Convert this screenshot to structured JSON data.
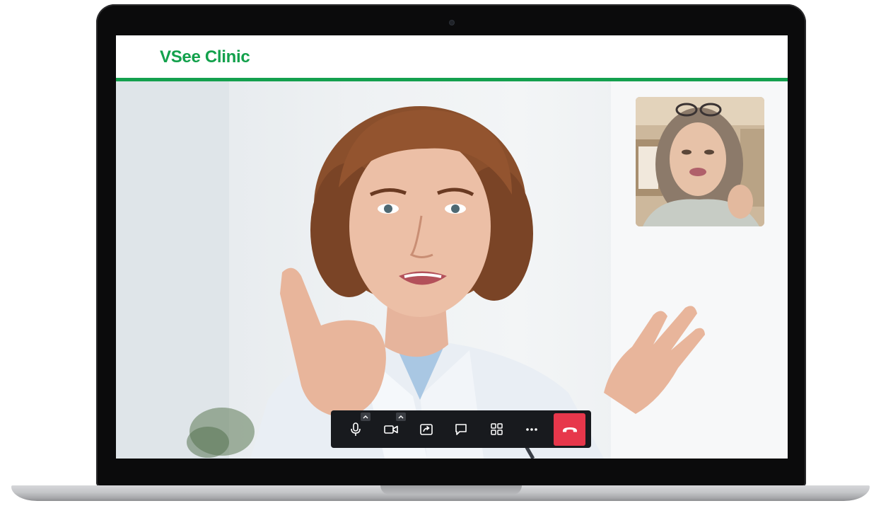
{
  "app": {
    "logo_text": "VSee Clinic",
    "brand_color": "#14a04e"
  },
  "toolbar": {
    "buttons": [
      {
        "name": "microphone",
        "icon": "microphone-icon",
        "has_menu": true
      },
      {
        "name": "camera",
        "icon": "video-camera-icon",
        "has_menu": true
      },
      {
        "name": "screen-share",
        "icon": "screen-share-icon",
        "has_menu": false
      },
      {
        "name": "chat",
        "icon": "chat-bubble-icon",
        "has_menu": false
      },
      {
        "name": "layout",
        "icon": "grid-layout-icon",
        "has_menu": false
      },
      {
        "name": "more",
        "icon": "more-dots-icon",
        "has_menu": false
      },
      {
        "name": "end-call",
        "icon": "hang-up-phone-icon",
        "has_menu": false
      }
    ],
    "end_call_color": "#e7374b",
    "background_color": "#181a1e"
  },
  "participants": {
    "main_video": "doctor-video-feed",
    "self_view": "patient-self-view"
  }
}
